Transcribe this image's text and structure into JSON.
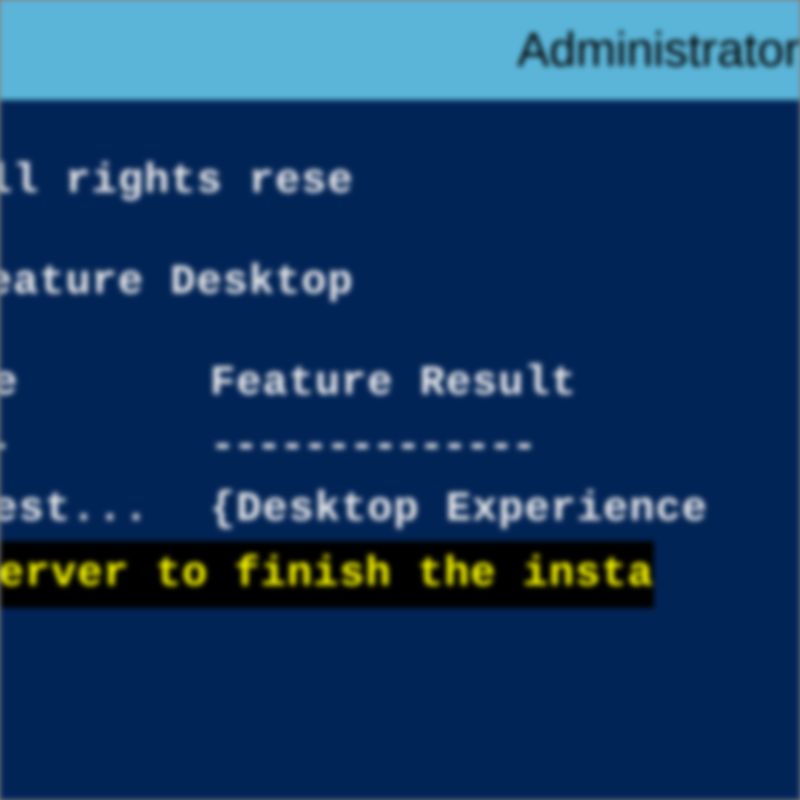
{
  "titlebar": {
    "title": "Administrator"
  },
  "console": {
    "copyright_line": "Corporation. All rights rese",
    "command_line": "stall-WindowsFeature Desktop",
    "header_col1": "ode",
    "header_col2": "Feature Result",
    "divider_col1": "---",
    "divider_col2": "--------------",
    "result_col1": "sRest...",
    "result_col2": "{Desktop Experience",
    "warning_line": "s server to finish the insta"
  }
}
